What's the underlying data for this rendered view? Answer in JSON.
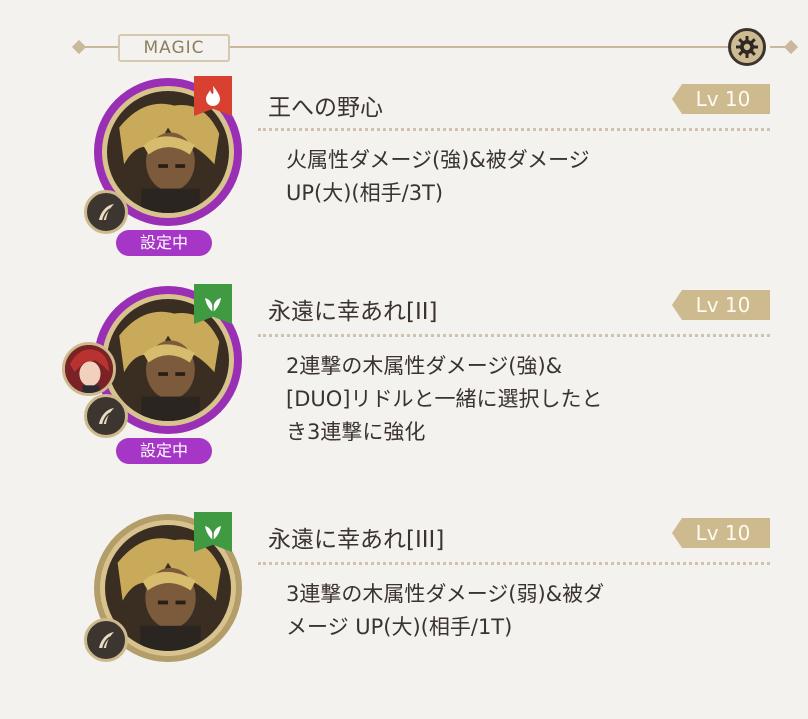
{
  "header": {
    "title": "MAGIC"
  },
  "icons": {
    "settings": "gear-icon",
    "category": "fang-icon",
    "fire": "fire-icon",
    "wood": "leaf-icon"
  },
  "colors": {
    "equipped": "#a636c6",
    "fire": "#d8402f",
    "wood": "#3f9a42",
    "level_bg": "#cdbb8f"
  },
  "skills": [
    {
      "name": "王への野心",
      "level": "Lv 10",
      "element": "fire",
      "equipped_label": "設定中",
      "desc_lines": [
        "火属性ダメージ(強)&被ダメージ",
        "UP(大)(相手/3T)"
      ]
    },
    {
      "name": "永遠に幸あれ[II]",
      "level": "Lv 10",
      "element": "wood",
      "equipped_label": "設定中",
      "desc_lines": [
        "2連撃の木属性ダメージ(強)&",
        "[DUO]リドルと一緒に選択したと",
        "き3連撃に強化"
      ]
    },
    {
      "name": "永遠に幸あれ[III]",
      "level": "Lv 10",
      "element": "wood",
      "desc_lines": [
        "3連撃の木属性ダメージ(弱)&被ダ",
        "メージ UP(大)(相手/1T)"
      ]
    }
  ]
}
